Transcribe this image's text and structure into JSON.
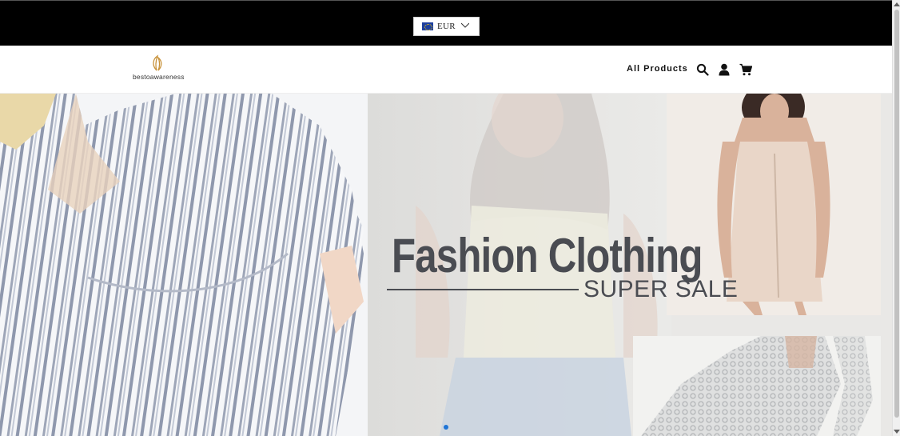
{
  "currency": {
    "code": "EUR",
    "flag": "eu-flag-icon"
  },
  "brand": {
    "name": "bestoawareness",
    "logo_color": "#c8923a"
  },
  "nav": {
    "all_products": "All Products"
  },
  "icons": {
    "search": "search-icon",
    "account": "user-icon",
    "cart": "cart-icon"
  },
  "hero": {
    "headline": "Fashion Clothing",
    "subline": "SUPER SALE",
    "text_color": "#4a4c52",
    "active_slide_color": "#1e74d6"
  }
}
